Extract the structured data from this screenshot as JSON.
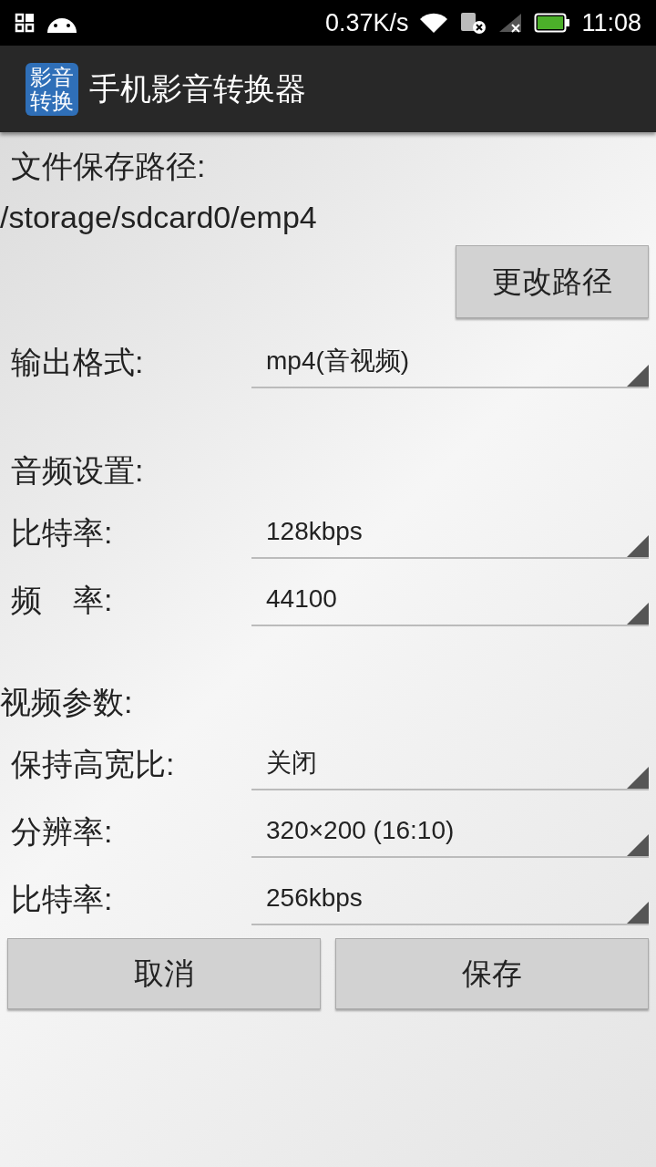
{
  "status_bar": {
    "network_speed": "0.37K/s",
    "time": "11:08"
  },
  "app_bar": {
    "icon_text": [
      "影音",
      "转换"
    ],
    "title": "手机影音转换器"
  },
  "save_path": {
    "label": "文件保存路径:",
    "path": "/storage/sdcard0/emp4",
    "button": "更改路径"
  },
  "output_format": {
    "label": "输出格式:",
    "value": "mp4(音视频)"
  },
  "audio": {
    "heading": "音频设置:",
    "rows": [
      {
        "label": "比特率:",
        "value": "128kbps"
      },
      {
        "label": "频　率:",
        "value": "44100"
      }
    ]
  },
  "video": {
    "heading": "视频参数:",
    "rows": [
      {
        "label": "保持高宽比:",
        "value": "关闭"
      },
      {
        "label": "分辨率:",
        "value": "320×200 (16:10)"
      },
      {
        "label": "比特率:",
        "value": "256kbps"
      }
    ]
  },
  "buttons": [
    "取消",
    "保存"
  ]
}
